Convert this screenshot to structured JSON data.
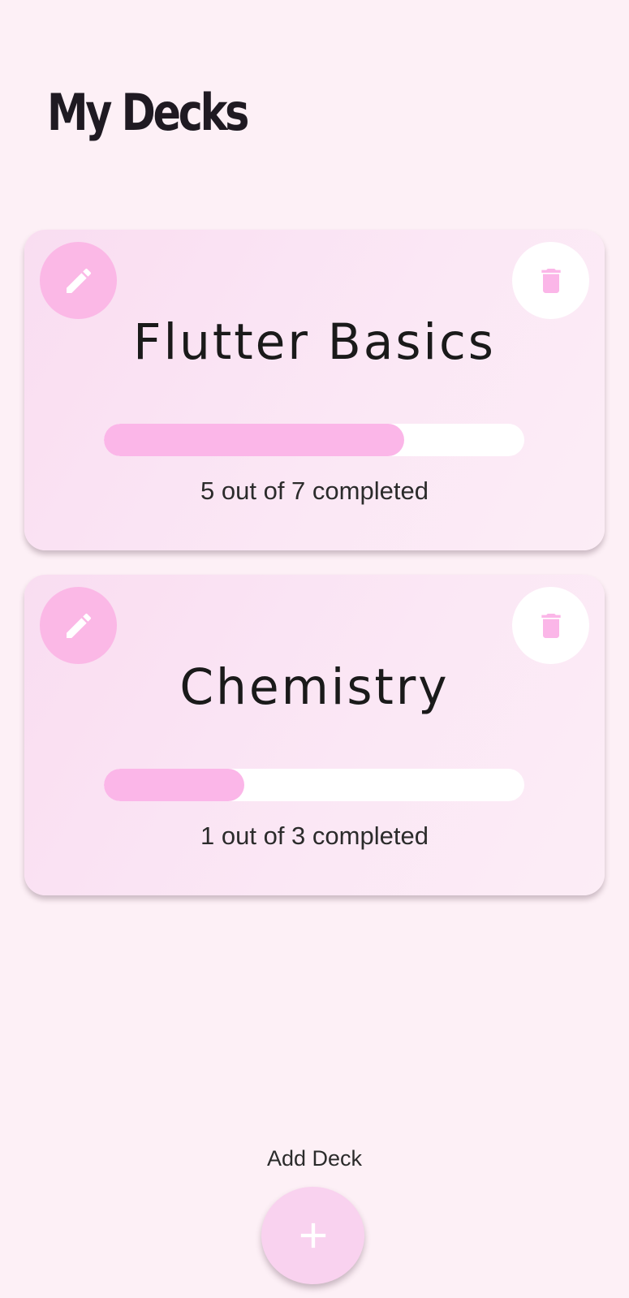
{
  "header": {
    "title": "My Decks"
  },
  "decks": [
    {
      "title": "Flutter Basics",
      "progress_text": "5 out of 7 completed",
      "completed": 5,
      "total": 7,
      "edit_icon": "pencil-icon",
      "delete_icon": "trash-icon"
    },
    {
      "title": "Chemistry",
      "progress_text": "1 out of 3 completed",
      "completed": 1,
      "total": 3,
      "edit_icon": "pencil-icon",
      "delete_icon": "trash-icon"
    }
  ],
  "add_deck": {
    "label": "Add Deck",
    "icon": "plus-icon"
  },
  "colors": {
    "background": "#fdf0f6",
    "accent": "#fbb6e8",
    "card": "#fbe7f5",
    "fab": "#f9d2ef"
  }
}
